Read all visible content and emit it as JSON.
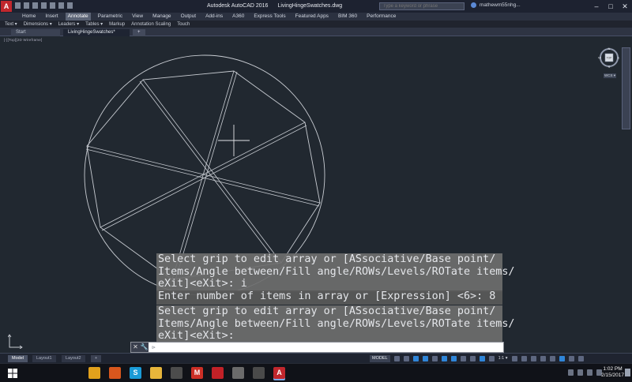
{
  "window": {
    "app_name": "Autodesk AutoCAD 2016",
    "file_name": "LivingHingeSwatches.dwg",
    "search_placeholder": "Type a keyword or phrase",
    "user_name": "mathewm55nhg..."
  },
  "ribbon": {
    "tabs": [
      "Home",
      "Insert",
      "Annotate",
      "Parametric",
      "View",
      "Manage",
      "Output",
      "Add-ins",
      "A360",
      "Express Tools",
      "Featured Apps",
      "BIM 360",
      "Performance"
    ],
    "active_tab": "Annotate"
  },
  "panel_bar": {
    "items": [
      "Text ▾",
      "Dimensions ▾",
      "Leaders ▾",
      "Tables ▾",
      "Markup",
      "Annotation Scaling",
      "Touch"
    ]
  },
  "doc_tabs": {
    "start": "Start",
    "active": "LivingHingeSwatches*",
    "add": "+"
  },
  "viewport": {
    "label": "[-][Top][2D Wireframe]",
    "viewcube_compass": {
      "n": "N",
      "s": "S",
      "e": "E",
      "w": "W",
      "center": "TOP"
    },
    "wcs_label": "WCS ▾"
  },
  "command_history": {
    "line1": "Select grip to edit array or [ASsociative/Base point/\nItems/Angle between/Fill angle/ROWs/Levels/ROTate items/\neXit]<eXit>: i",
    "line2": "Enter number of items in array or [Expression] <6>: 8",
    "line3": "Select grip to edit array or [ASsociative/Base point/\nItems/Angle between/Fill angle/ROWs/Levels/ROTate items/\neXit]<eXit>:"
  },
  "command_line": {
    "prompt": "⊳",
    "close_icon": "✕",
    "customize_icon": "🔧",
    "value": ""
  },
  "layout_tabs": [
    "Model",
    "Layout1",
    "Layout2",
    "+"
  ],
  "status_bar": {
    "model": "MODEL",
    "scale": "1:1 ▾"
  },
  "taskbar": {
    "apps": [
      {
        "name": "chrome",
        "glyph": "",
        "color": "#e2a11c"
      },
      {
        "name": "firefox",
        "glyph": "",
        "color": "#d8571d"
      },
      {
        "name": "skype",
        "glyph": "S",
        "color": "#1a9bd7"
      },
      {
        "name": "explorer",
        "glyph": "",
        "color": "#e7b53b"
      },
      {
        "name": "antenna",
        "glyph": "",
        "color": "#4c4c4c"
      },
      {
        "name": "gmail",
        "glyph": "M",
        "color": "#cc2f26"
      },
      {
        "name": "acrobat",
        "glyph": "",
        "color": "#c22127"
      },
      {
        "name": "media",
        "glyph": "",
        "color": "#6b6b6b"
      },
      {
        "name": "photos",
        "glyph": "",
        "color": "#4a4a4a"
      },
      {
        "name": "autocad",
        "glyph": "A",
        "color": "#c1272d"
      }
    ],
    "time": "1:02 PM",
    "date": "2/15/2017"
  },
  "colors": {
    "canvas": "#212830",
    "geometry": "#c8ccd2",
    "command_history_bg": "#6e6e6e"
  }
}
